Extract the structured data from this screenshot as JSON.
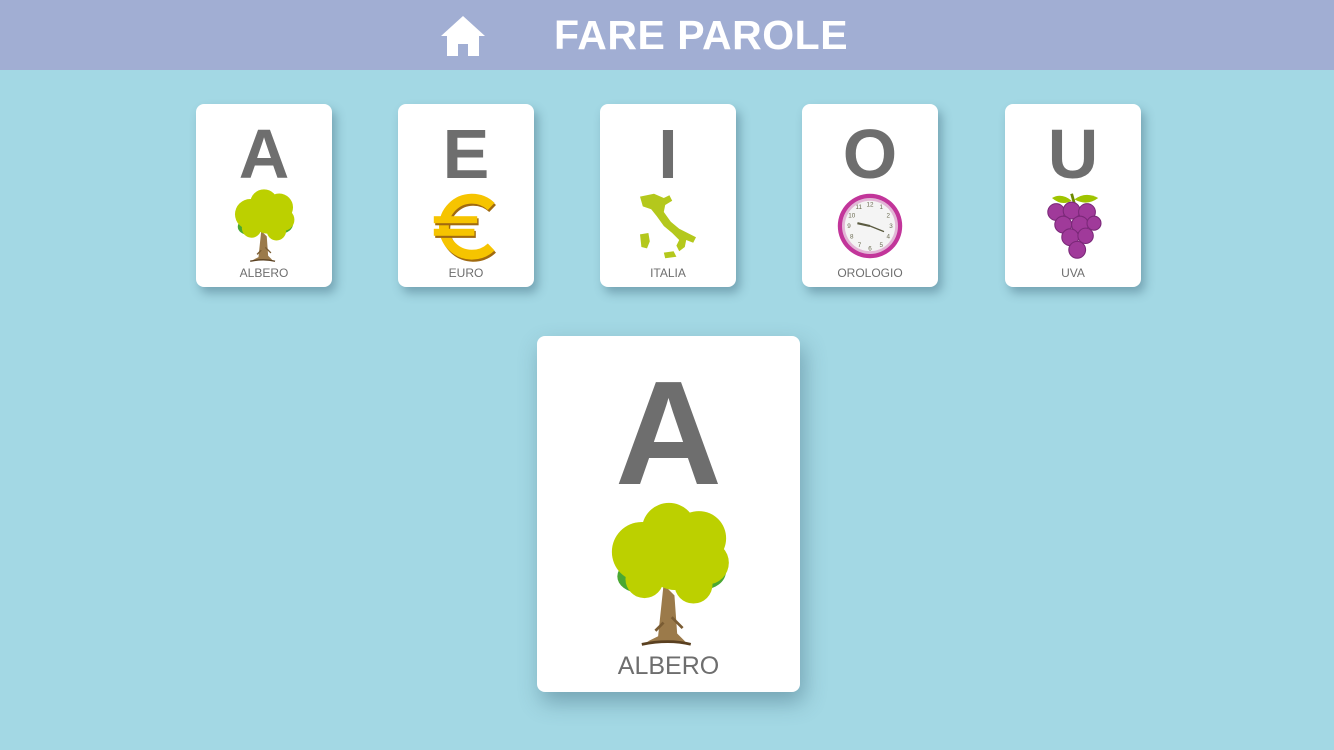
{
  "header": {
    "title": "FARE PAROLE",
    "home_icon": "home-icon",
    "background": "#a1aed3"
  },
  "cards": [
    {
      "letter": "A",
      "word": "ALBERO",
      "icon": "tree-icon"
    },
    {
      "letter": "E",
      "word": "EURO",
      "icon": "euro-icon"
    },
    {
      "letter": "I",
      "word": "ITALIA",
      "icon": "italy-map-icon"
    },
    {
      "letter": "O",
      "word": "OROLOGIO",
      "icon": "clock-icon"
    },
    {
      "letter": "U",
      "word": "UVA",
      "icon": "grapes-icon"
    }
  ],
  "selected_card": {
    "letter": "A",
    "word": "ALBERO",
    "icon": "tree-icon"
  },
  "colors": {
    "background": "#a3d8e4",
    "text": "#6e6e6e",
    "card": "#ffffff"
  }
}
